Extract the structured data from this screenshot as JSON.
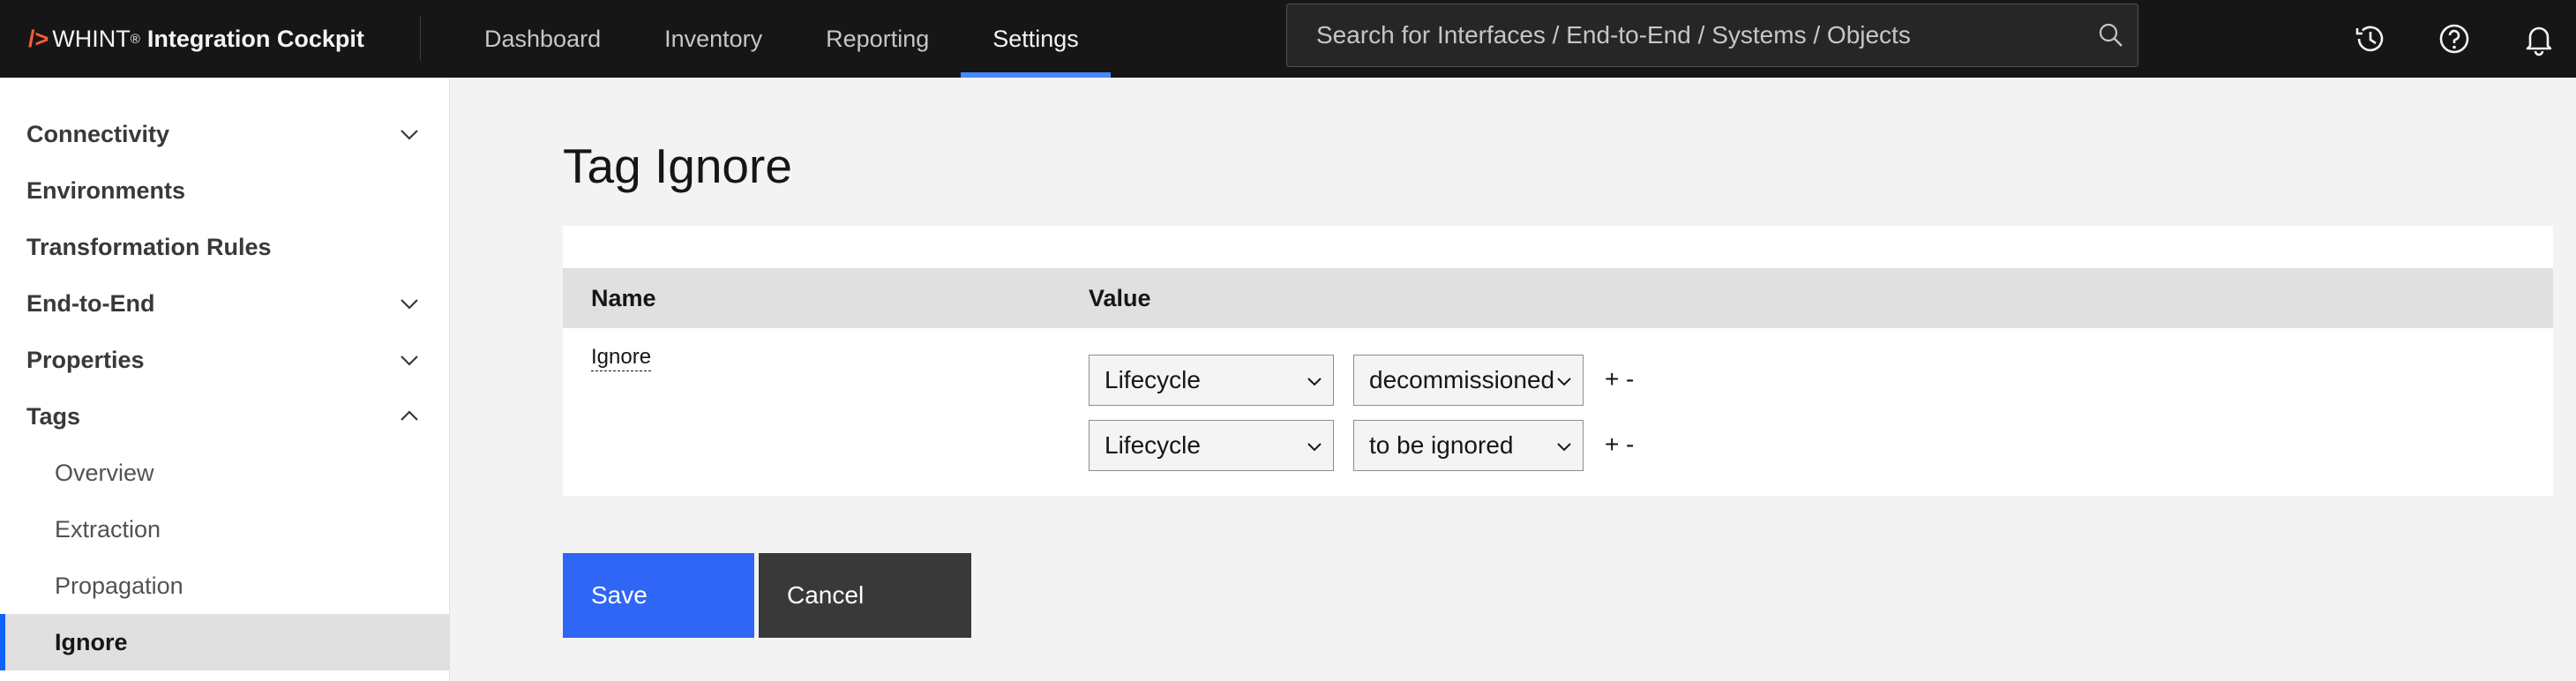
{
  "header": {
    "brand_slash": "/>",
    "brand_whint": "WHINT",
    "brand_reg": "®",
    "brand_product": "Integration Cockpit",
    "nav": [
      {
        "label": "Dashboard"
      },
      {
        "label": "Inventory"
      },
      {
        "label": "Reporting"
      },
      {
        "label": "Settings",
        "active": true
      }
    ],
    "search_placeholder": "Search for Interfaces / End-to-End / Systems / Objects",
    "icons": [
      "search-icon",
      "history-icon",
      "help-icon",
      "notification-icon"
    ],
    "accent_color": "#4589ff"
  },
  "sidebar": {
    "items": [
      {
        "label": "Connectivity",
        "expandable": true,
        "expanded": false
      },
      {
        "label": "Environments"
      },
      {
        "label": "Transformation Rules"
      },
      {
        "label": "End-to-End",
        "expandable": true,
        "expanded": false
      },
      {
        "label": "Properties",
        "expandable": true,
        "expanded": false
      },
      {
        "label": "Tags",
        "expandable": true,
        "expanded": true
      }
    ],
    "sub_items": [
      {
        "label": "Overview"
      },
      {
        "label": "Extraction"
      },
      {
        "label": "Propagation"
      },
      {
        "label": "Ignore",
        "active": true
      }
    ],
    "active_indicator_color": "#0f62fe"
  },
  "main": {
    "title": "Tag Ignore",
    "table": {
      "columns": [
        "Name",
        "Value"
      ],
      "row_name": "Ignore",
      "value_rows": [
        {
          "tag": "Lifecycle",
          "value": "decommissioned",
          "plus": "+",
          "minus": "-"
        },
        {
          "tag": "Lifecycle",
          "value": "to be ignored",
          "plus": "+",
          "minus": "-"
        }
      ]
    },
    "buttons": {
      "save": "Save",
      "cancel": "Cancel"
    },
    "primary_color": "#2f66f6"
  }
}
